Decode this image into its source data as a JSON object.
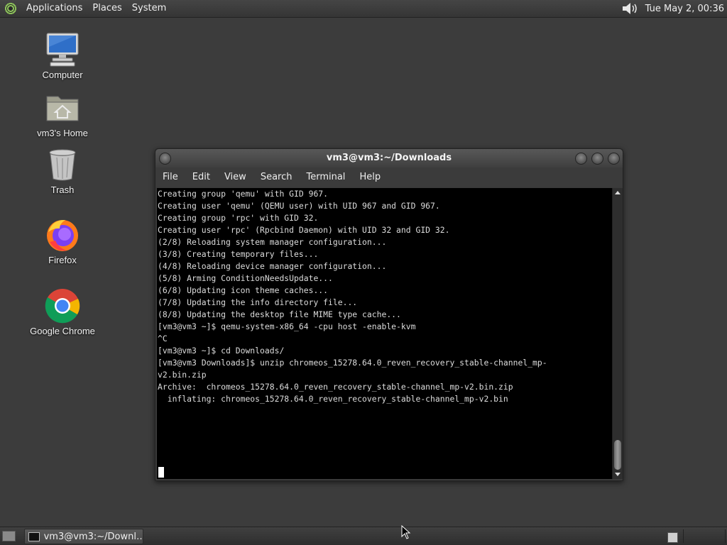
{
  "top_panel": {
    "menus": [
      "Applications",
      "Places",
      "System"
    ],
    "clock": "Tue May  2, 00:36",
    "icons": {
      "menu_logo": "distro-logo-icon",
      "volume": "speaker-icon"
    }
  },
  "desktop": {
    "icons": [
      {
        "label": "Computer",
        "icon": "computer-icon"
      },
      {
        "label": "vm3's Home",
        "icon": "home-folder-icon"
      },
      {
        "label": "Trash",
        "icon": "trash-icon"
      },
      {
        "label": "Firefox",
        "icon": "firefox-icon"
      },
      {
        "label": "Google Chrome",
        "icon": "chrome-icon"
      }
    ]
  },
  "terminal": {
    "title": "vm3@vm3:~/Downloads",
    "menus": [
      "File",
      "Edit",
      "View",
      "Search",
      "Terminal",
      "Help"
    ],
    "lines": [
      "Creating group 'qemu' with GID 967.",
      "Creating user 'qemu' (QEMU user) with UID 967 and GID 967.",
      "Creating group 'rpc' with GID 32.",
      "Creating user 'rpc' (Rpcbind Daemon) with UID 32 and GID 32.",
      "(2/8) Reloading system manager configuration...",
      "(3/8) Creating temporary files...",
      "(4/8) Reloading device manager configuration...",
      "(5/8) Arming ConditionNeedsUpdate...",
      "(6/8) Updating icon theme caches...",
      "(7/8) Updating the info directory file...",
      "(8/8) Updating the desktop file MIME type cache...",
      "[vm3@vm3 ~]$ qemu-system-x86_64 -cpu host -enable-kvm",
      "^C",
      "[vm3@vm3 ~]$ cd Downloads/",
      "[vm3@vm3 Downloads]$ unzip chromeos_15278.64.0_reven_recovery_stable-channel_mp-",
      "v2.bin.zip",
      "Archive:  chromeos_15278.64.0_reven_recovery_stable-channel_mp-v2.bin.zip",
      "  inflating: chromeos_15278.64.0_reven_recovery_stable-channel_mp-v2.bin"
    ]
  },
  "bottom_panel": {
    "task_label": "vm3@vm3:~/Downl…",
    "icons": {
      "show_desktop": "show-desktop-icon",
      "task": "terminal-icon"
    }
  },
  "colors": {
    "desktop_bg": "#3c3c3c",
    "terminal_bg": "#000000",
    "terminal_fg": "#dcdcdc"
  }
}
